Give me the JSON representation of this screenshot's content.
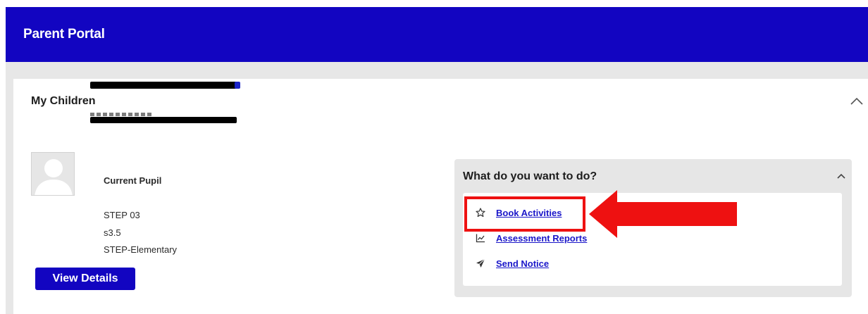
{
  "header": {
    "title": "Parent Portal",
    "background": "#1205c1"
  },
  "children_card": {
    "title": "My Children",
    "collapse_icon": "chevron-up-icon",
    "pupil": {
      "avatar_icon": "user-placeholder-icon",
      "name": "",
      "status": "Current Pupil",
      "date_of_birth": "",
      "step": "STEP 03",
      "level": "s3.5",
      "program": "STEP-Elementary"
    },
    "view_details_label": "View Details"
  },
  "actions_panel": {
    "title": "What do you want to do?",
    "collapse_icon": "chevron-up-icon",
    "items": [
      {
        "label": "Book Activities",
        "icon": "star-outline-icon"
      },
      {
        "label": "Assessment Reports",
        "icon": "chart-line-icon"
      },
      {
        "label": "Send Notice",
        "icon": "paper-plane-icon"
      }
    ]
  },
  "annotation": {
    "highlight_color": "#ee1111",
    "target": "Book Activities"
  }
}
